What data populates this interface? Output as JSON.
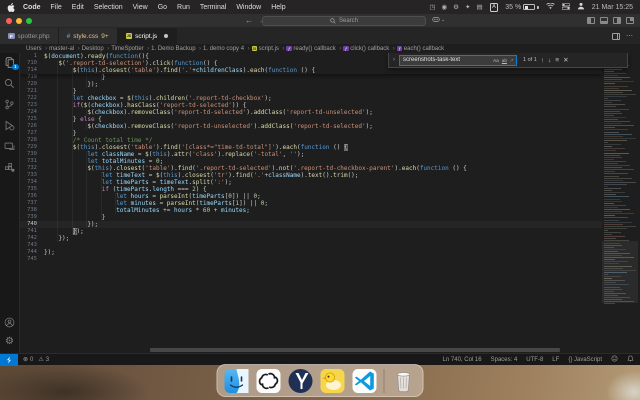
{
  "colors": {
    "accent": "#0078d4",
    "editor_bg": "#1e1e1e",
    "statusbar_bg": "#181818",
    "find_focus_border": "#0a7fd4",
    "keyword": "#569cd6",
    "control": "#c586c0",
    "string": "#ce9178",
    "function": "#dcdcaa",
    "variable": "#9cdcfe",
    "number": "#b5cea8",
    "comment": "#6a9955"
  },
  "menu_bar": {
    "items": [
      "Code",
      "File",
      "Edit",
      "Selection",
      "View",
      "Go",
      "Run",
      "Terminal",
      "Window",
      "Help"
    ],
    "status_icons": [
      {
        "name": "menu-extra-icon-1",
        "glyph": "◳"
      },
      {
        "name": "menu-extra-icon-2",
        "glyph": "◉"
      },
      {
        "name": "menu-extra-icon-3",
        "glyph": "⚙"
      },
      {
        "name": "menu-extra-icon-4",
        "glyph": "✦"
      },
      {
        "name": "menu-extra-icon-5",
        "glyph": "▤"
      }
    ],
    "input_source": "A",
    "battery": "35 %",
    "clock": "21 Mar 15:25"
  },
  "titlebar": {
    "search_placeholder": "Search"
  },
  "tabbar": {
    "tabs": [
      {
        "label": "spotter.php",
        "icon": "php",
        "icon_text": "P",
        "active": false,
        "dirty": false,
        "badge": ""
      },
      {
        "label": "style.css",
        "icon": "css",
        "icon_text": "#",
        "active": false,
        "dirty": false,
        "badge": "9+",
        "modified": true
      },
      {
        "label": "script.js",
        "icon": "js",
        "icon_text": "JS",
        "active": true,
        "dirty": true,
        "badge": ""
      }
    ]
  },
  "breadcrumbs": [
    {
      "label": "Users"
    },
    {
      "label": "master-al"
    },
    {
      "label": "Desktop"
    },
    {
      "label": "TimeSpotter"
    },
    {
      "label": "1. Demo Backup"
    },
    {
      "label": "1. demo copy 4"
    },
    {
      "label": "script.js",
      "icon": "js"
    },
    {
      "label": "ready() callback",
      "icon": "symbol"
    },
    {
      "label": "click() callback",
      "icon": "symbol"
    },
    {
      "label": "each() callback",
      "icon": "symbol"
    }
  ],
  "find_widget": {
    "query": "screenshots-task-text",
    "match_case": "Aa",
    "whole_word": "ab",
    "regex": ".*",
    "results": "1 of 1",
    "prev": "↑",
    "next": "↓",
    "in_selection": "≡",
    "close": "✕"
  },
  "activity_bar": {
    "explorer_badge": "1"
  },
  "editor": {
    "sticky_lines": [
      {
        "n": "1",
        "ind": 0,
        "t": [
          [
            "$",
            "f"
          ],
          [
            "(",
            "p"
          ],
          [
            "document",
            "v"
          ],
          [
            ").",
            "p"
          ],
          [
            "ready",
            "f"
          ],
          [
            "(",
            "p"
          ],
          [
            "function",
            "k"
          ],
          [
            "(){",
            "p"
          ]
        ]
      },
      {
        "n": "710",
        "ind": 4,
        "t": [
          [
            "$",
            "f"
          ],
          [
            "(",
            "p"
          ],
          [
            "'.report-td-selection'",
            "s"
          ],
          [
            ").",
            "p"
          ],
          [
            "click",
            "f"
          ],
          [
            "(",
            "p"
          ],
          [
            "function",
            "k"
          ],
          [
            "() {",
            "p"
          ]
        ]
      },
      {
        "n": "714",
        "ind": 8,
        "t": [
          [
            "$",
            "f"
          ],
          [
            "(",
            "p"
          ],
          [
            "this",
            "k"
          ],
          [
            ").",
            "p"
          ],
          [
            "closest",
            "f"
          ],
          [
            "(",
            "p"
          ],
          [
            "'table'",
            "s"
          ],
          [
            ").",
            "p"
          ],
          [
            "find",
            "f"
          ],
          [
            "(",
            "p"
          ],
          [
            "'.'",
            "s"
          ],
          [
            "+",
            "p"
          ],
          [
            "childrenClass",
            "v"
          ],
          [
            ").",
            "p"
          ],
          [
            "each",
            "f"
          ],
          [
            "(",
            "p"
          ],
          [
            "function",
            "k"
          ],
          [
            " () {",
            "p"
          ]
        ]
      }
    ],
    "lines": [
      {
        "n": "719",
        "ind": 16,
        "t": [
          [
            "}",
            "p"
          ]
        ]
      },
      {
        "n": "720",
        "ind": 12,
        "t": [
          [
            "});",
            "p"
          ]
        ]
      },
      {
        "n": "721",
        "ind": 8,
        "t": [
          [
            "}",
            "p"
          ]
        ]
      },
      {
        "n": "722",
        "ind": 8,
        "t": [
          [
            "let",
            "k"
          ],
          [
            " ",
            "p"
          ],
          [
            "checkbox",
            "v"
          ],
          [
            " = ",
            "p"
          ],
          [
            "$",
            "f"
          ],
          [
            "(",
            "p"
          ],
          [
            "this",
            "k"
          ],
          [
            ").",
            "p"
          ],
          [
            "children",
            "f"
          ],
          [
            "(",
            "p"
          ],
          [
            "'.report-td-checkbox'",
            "s"
          ],
          [
            ");",
            "p"
          ]
        ]
      },
      {
        "n": "723",
        "ind": 8,
        "t": [
          [
            "if",
            "kc"
          ],
          [
            "(",
            "p"
          ],
          [
            "$",
            "f"
          ],
          [
            "(",
            "p"
          ],
          [
            "checkbox",
            "v"
          ],
          [
            ").",
            "p"
          ],
          [
            "hasClass",
            "f"
          ],
          [
            "(",
            "p"
          ],
          [
            "'report-td-selected'",
            "s"
          ],
          [
            ")) {",
            "p"
          ]
        ]
      },
      {
        "n": "724",
        "ind": 12,
        "t": [
          [
            "$",
            "f"
          ],
          [
            "(",
            "p"
          ],
          [
            "checkbox",
            "v"
          ],
          [
            ").",
            "p"
          ],
          [
            "removeClass",
            "f"
          ],
          [
            "(",
            "p"
          ],
          [
            "'report-td-selected'",
            "s"
          ],
          [
            ").",
            "p"
          ],
          [
            "addClass",
            "f"
          ],
          [
            "(",
            "p"
          ],
          [
            "'report-td-unselected'",
            "s"
          ],
          [
            ");",
            "p"
          ]
        ]
      },
      {
        "n": "725",
        "ind": 8,
        "t": [
          [
            "} ",
            "p"
          ],
          [
            "else",
            "kc"
          ],
          [
            " {",
            "p"
          ]
        ]
      },
      {
        "n": "726",
        "ind": 12,
        "t": [
          [
            "$",
            "f"
          ],
          [
            "(",
            "p"
          ],
          [
            "checkbox",
            "v"
          ],
          [
            ").",
            "p"
          ],
          [
            "removeClass",
            "f"
          ],
          [
            "(",
            "p"
          ],
          [
            "'report-td-unselected'",
            "s"
          ],
          [
            ").",
            "p"
          ],
          [
            "addClass",
            "f"
          ],
          [
            "(",
            "p"
          ],
          [
            "'report-td-selected'",
            "s"
          ],
          [
            ");",
            "p"
          ]
        ]
      },
      {
        "n": "727",
        "ind": 8,
        "t": [
          [
            "}",
            "p"
          ]
        ]
      },
      {
        "n": "728",
        "ind": 8,
        "t": [
          [
            "/* Count total time */",
            "c"
          ]
        ]
      },
      {
        "n": "729",
        "ind": 8,
        "t": [
          [
            "$",
            "f"
          ],
          [
            "(",
            "p"
          ],
          [
            "this",
            "k"
          ],
          [
            ").",
            "p"
          ],
          [
            "closest",
            "f"
          ],
          [
            "(",
            "p"
          ],
          [
            "'table'",
            "s"
          ],
          [
            ").",
            "p"
          ],
          [
            "find",
            "f"
          ],
          [
            "(",
            "p"
          ],
          [
            "'[class*=\"time-td-total\"]'",
            "s"
          ],
          [
            ").",
            "p"
          ],
          [
            "each",
            "f"
          ],
          [
            "(",
            "p"
          ],
          [
            "function",
            "k"
          ],
          [
            " () ",
            "p"
          ],
          [
            "{",
            "bm"
          ]
        ]
      },
      {
        "n": "730",
        "ind": 12,
        "t": [
          [
            "let",
            "k"
          ],
          [
            " ",
            "p"
          ],
          [
            "className",
            "v"
          ],
          [
            " = ",
            "p"
          ],
          [
            "$",
            "f"
          ],
          [
            "(",
            "p"
          ],
          [
            "this",
            "k"
          ],
          [
            ").",
            "p"
          ],
          [
            "attr",
            "f"
          ],
          [
            "(",
            "p"
          ],
          [
            "'class'",
            "s"
          ],
          [
            ").",
            "p"
          ],
          [
            "replace",
            "f"
          ],
          [
            "(",
            "p"
          ],
          [
            "'-total'",
            "s"
          ],
          [
            ", ",
            "p"
          ],
          [
            "''",
            "s"
          ],
          [
            ");",
            "p"
          ]
        ]
      },
      {
        "n": "731",
        "ind": 12,
        "t": [
          [
            "let",
            "k"
          ],
          [
            " ",
            "p"
          ],
          [
            "totalMinutes",
            "v"
          ],
          [
            " = ",
            "p"
          ],
          [
            "0",
            "n"
          ],
          [
            ";",
            "p"
          ]
        ]
      },
      {
        "n": "732",
        "ind": 12,
        "t": [
          [
            "$",
            "f"
          ],
          [
            "(",
            "p"
          ],
          [
            "this",
            "k"
          ],
          [
            ").",
            "p"
          ],
          [
            "closest",
            "f"
          ],
          [
            "(",
            "p"
          ],
          [
            "'table'",
            "s"
          ],
          [
            ").",
            "p"
          ],
          [
            "find",
            "f"
          ],
          [
            "(",
            "p"
          ],
          [
            "'.report-td-selected'",
            "s"
          ],
          [
            ").",
            "p"
          ],
          [
            "not",
            "f"
          ],
          [
            "(",
            "p"
          ],
          [
            "'.report-td-checkbox-parent'",
            "s"
          ],
          [
            ").",
            "p"
          ],
          [
            "each",
            "f"
          ],
          [
            "(",
            "p"
          ],
          [
            "function",
            "k"
          ],
          [
            " () {",
            "p"
          ]
        ]
      },
      {
        "n": "733",
        "ind": 16,
        "t": [
          [
            "let",
            "k"
          ],
          [
            " ",
            "p"
          ],
          [
            "timeText",
            "v"
          ],
          [
            " = ",
            "p"
          ],
          [
            "$",
            "f"
          ],
          [
            "(",
            "p"
          ],
          [
            "this",
            "k"
          ],
          [
            ").",
            "p"
          ],
          [
            "closest",
            "f"
          ],
          [
            "(",
            "p"
          ],
          [
            "'tr'",
            "s"
          ],
          [
            ").",
            "p"
          ],
          [
            "find",
            "f"
          ],
          [
            "(",
            "p"
          ],
          [
            "'.'",
            "s"
          ],
          [
            "+",
            "p"
          ],
          [
            "className",
            "v"
          ],
          [
            ").",
            "p"
          ],
          [
            "text",
            "f"
          ],
          [
            "().",
            "p"
          ],
          [
            "trim",
            "f"
          ],
          [
            "();",
            "p"
          ]
        ]
      },
      {
        "n": "734",
        "ind": 16,
        "t": [
          [
            "let",
            "k"
          ],
          [
            " ",
            "p"
          ],
          [
            "timeParts",
            "v"
          ],
          [
            " = ",
            "p"
          ],
          [
            "timeText",
            "v"
          ],
          [
            ".",
            "p"
          ],
          [
            "split",
            "f"
          ],
          [
            "(",
            "p"
          ],
          [
            "':'",
            "s"
          ],
          [
            ");",
            "p"
          ]
        ]
      },
      {
        "n": "735",
        "ind": 16,
        "t": [
          [
            "if",
            "kc"
          ],
          [
            " (",
            "p"
          ],
          [
            "timeParts",
            "v"
          ],
          [
            ".",
            "p"
          ],
          [
            "length",
            "v"
          ],
          [
            " === ",
            "p"
          ],
          [
            "2",
            "n"
          ],
          [
            ") {",
            "p"
          ]
        ]
      },
      {
        "n": "736",
        "ind": 20,
        "t": [
          [
            "let",
            "k"
          ],
          [
            " ",
            "p"
          ],
          [
            "hours",
            "v"
          ],
          [
            " = ",
            "p"
          ],
          [
            "parseInt",
            "f"
          ],
          [
            "(",
            "p"
          ],
          [
            "timeParts",
            "v"
          ],
          [
            "[",
            "p"
          ],
          [
            "0",
            "n"
          ],
          [
            "]) || ",
            "p"
          ],
          [
            "0",
            "n"
          ],
          [
            ";",
            "p"
          ]
        ]
      },
      {
        "n": "737",
        "ind": 20,
        "t": [
          [
            "let",
            "k"
          ],
          [
            " ",
            "p"
          ],
          [
            "minutes",
            "v"
          ],
          [
            " = ",
            "p"
          ],
          [
            "parseInt",
            "f"
          ],
          [
            "(",
            "p"
          ],
          [
            "timeParts",
            "v"
          ],
          [
            "[",
            "p"
          ],
          [
            "1",
            "n"
          ],
          [
            "]) || ",
            "p"
          ],
          [
            "0",
            "n"
          ],
          [
            ";",
            "p"
          ]
        ]
      },
      {
        "n": "738",
        "ind": 20,
        "t": [
          [
            "totalMinutes",
            "v"
          ],
          [
            " += ",
            "p"
          ],
          [
            "hours",
            "v"
          ],
          [
            " * ",
            "p"
          ],
          [
            "60",
            "n"
          ],
          [
            " + ",
            "p"
          ],
          [
            "minutes",
            "v"
          ],
          [
            ";",
            "p"
          ]
        ]
      },
      {
        "n": "739",
        "ind": 16,
        "t": [
          [
            "}",
            "p"
          ]
        ]
      },
      {
        "n": "740",
        "ind": 12,
        "cur": true,
        "t": [
          [
            "});",
            "p"
          ]
        ]
      },
      {
        "n": "741",
        "ind": 8,
        "t": [
          [
            "}",
            "bm"
          ],
          [
            ");",
            "p"
          ]
        ]
      },
      {
        "n": "742",
        "ind": 4,
        "t": [
          [
            "});",
            "p"
          ]
        ]
      },
      {
        "n": "743",
        "ind": 0,
        "t": []
      },
      {
        "n": "744",
        "ind": 0,
        "t": [
          [
            "});",
            "p"
          ]
        ]
      },
      {
        "n": "745",
        "ind": 0,
        "t": []
      }
    ]
  },
  "status_bar": {
    "errors": "0",
    "warnings": "3",
    "cursor": "Ln 740, Col 16",
    "spaces": "Spaces: 4",
    "encoding": "UTF-8",
    "eol": "LF",
    "language": "{} JavaScript"
  },
  "dock": [
    "finder",
    "chatgpt",
    "yandex-browser",
    "duck-app",
    "vscode",
    "trash"
  ]
}
